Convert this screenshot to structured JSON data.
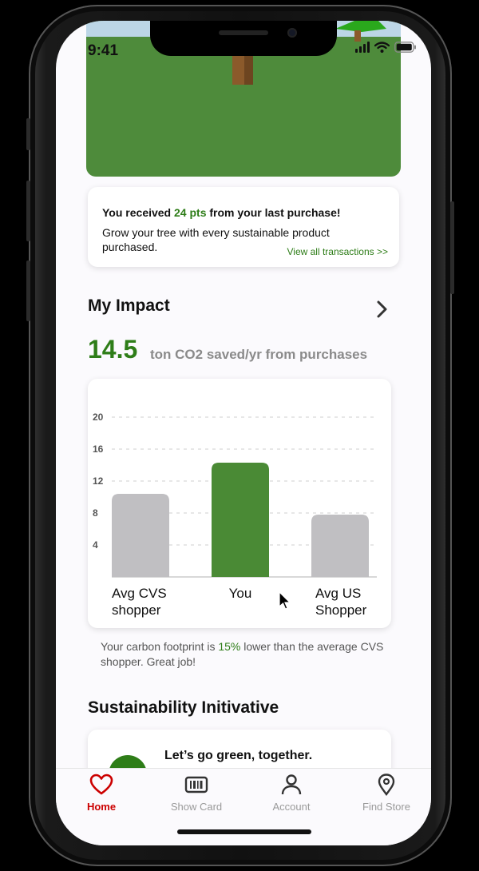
{
  "status": {
    "time": "9:41"
  },
  "points_card": {
    "prefix": "You received ",
    "points": "24 pts",
    "suffix": " from your last purchase!",
    "body": "Grow your tree with every sustainable product purchased.",
    "link": "View all transactions >>"
  },
  "impact": {
    "title": "My Impact",
    "value": "14.5",
    "unit": "ton CO2 saved/yr from purchases"
  },
  "chart_data": {
    "type": "bar",
    "categories": [
      "Avg CVS shopper",
      "You",
      "Avg US Shopper"
    ],
    "values": [
      10.4,
      14.3,
      7.8
    ],
    "colors": [
      "#c0bfc2",
      "#4a8a35",
      "#c0bfc2"
    ],
    "yticks": [
      4,
      8,
      12,
      16,
      20
    ],
    "ylim": [
      0,
      21
    ],
    "grid": true,
    "grid_style": "dashed"
  },
  "footnote": {
    "prefix": "Your carbon footprint is ",
    "percent": "15%",
    "suffix": " lower than the average CVS shopper. Great job!"
  },
  "sustainability": {
    "title": "Sustainability Initivative",
    "card_title": "Let’s go green, together."
  },
  "tabs": [
    {
      "label": "Home",
      "icon": "heart-icon",
      "active": true
    },
    {
      "label": "Show Card",
      "icon": "barcode-card-icon",
      "active": false
    },
    {
      "label": "Account",
      "icon": "person-icon",
      "active": false
    },
    {
      "label": "Find Store",
      "icon": "location-pin-icon",
      "active": false
    }
  ],
  "colors": {
    "brand_green": "#2e7d18",
    "brand_red": "#cc0000",
    "bar_gray": "#c0bfc2",
    "bar_green": "#4a8a35"
  }
}
